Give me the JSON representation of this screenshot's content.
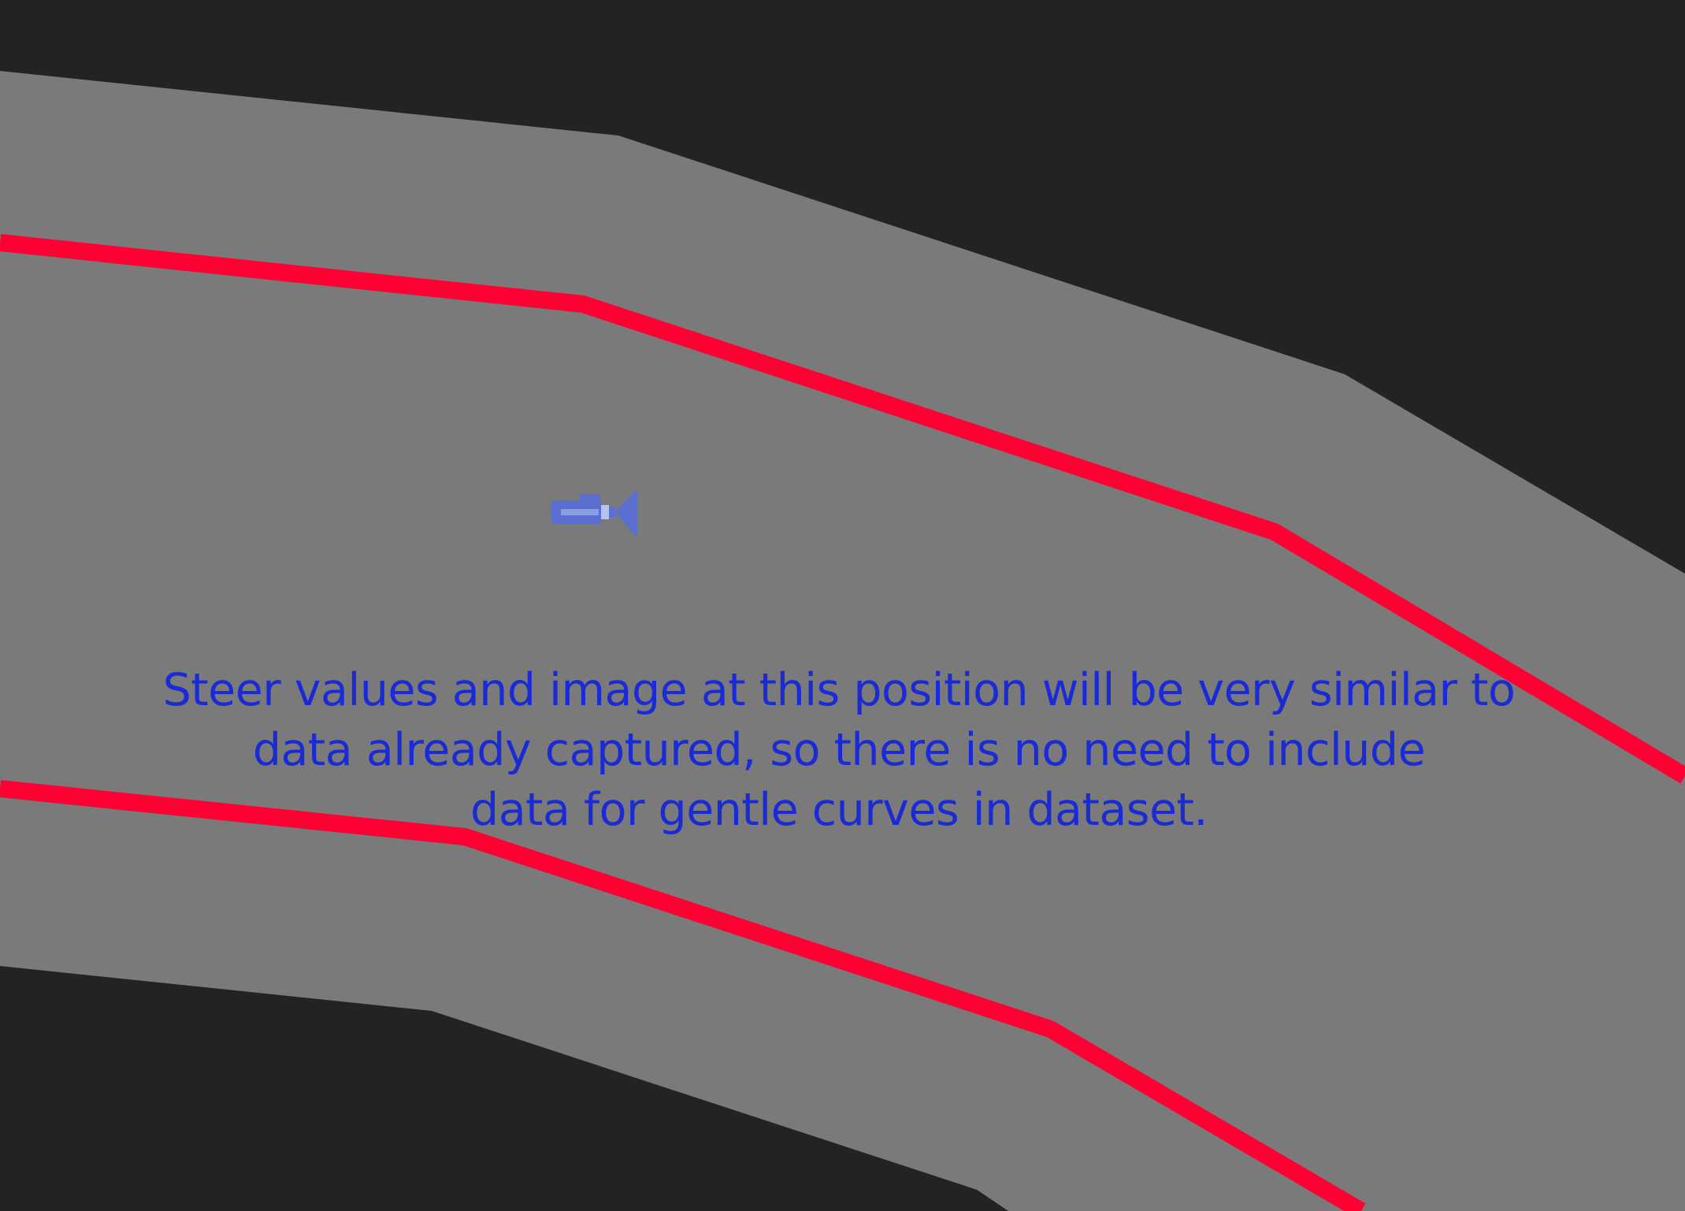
{
  "scene": {
    "colors": {
      "background": "#232323",
      "track_surface": "#7a7a7a",
      "lane_line": "#ff0033",
      "camera": "#5a6fd0",
      "camera_lens": "#b8c2ee",
      "caption_text": "#1a2bd6"
    },
    "icon": "camera-icon"
  },
  "caption": {
    "lines": [
      "Steer values and image at this position will be very similar to",
      "data already captured, so there is no need to include",
      "data for gentle curves in dataset."
    ]
  }
}
